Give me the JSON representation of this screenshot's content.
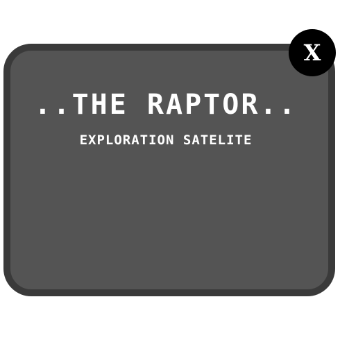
{
  "dialog": {
    "title": "..THE RAPTOR..",
    "subtitle": "EXPLORATION SATELITE",
    "close_label": "X"
  },
  "colors": {
    "panel_fill": "#545454",
    "panel_border": "#3a3a3a",
    "close_button_bg": "#000000",
    "text": "#ffffff"
  }
}
